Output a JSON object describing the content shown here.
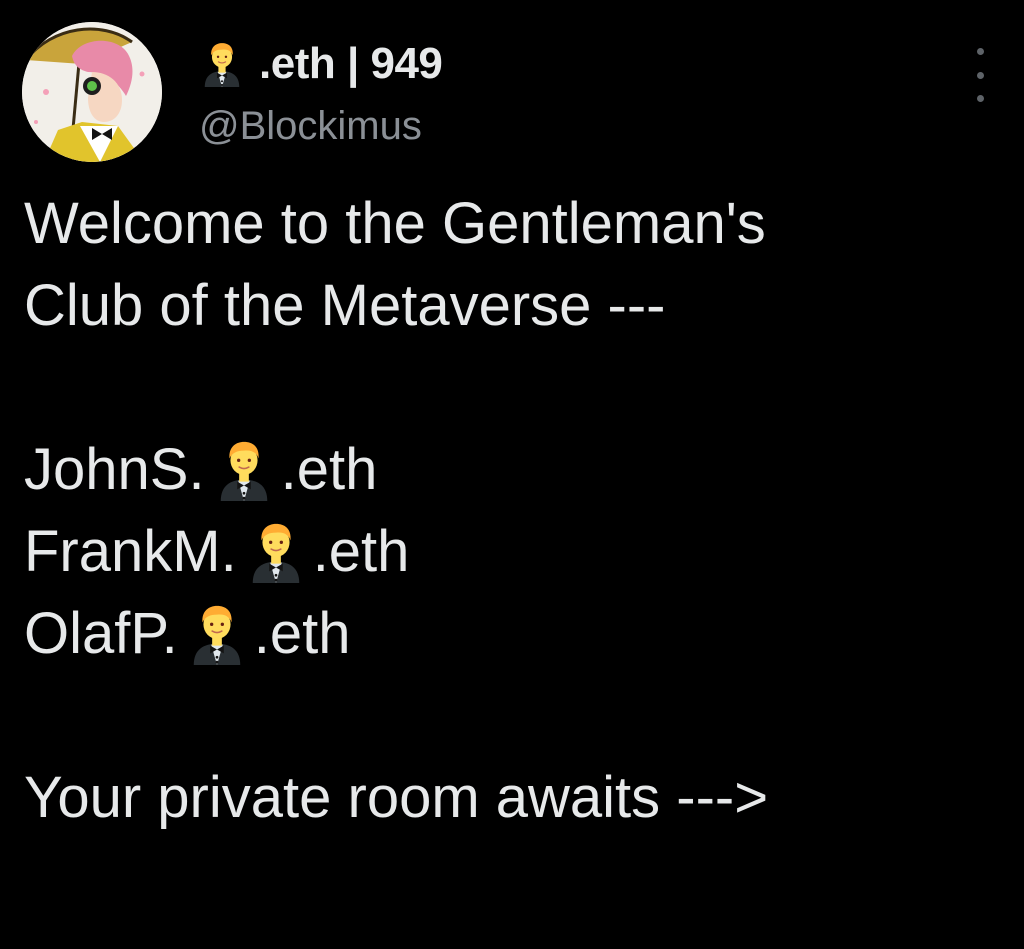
{
  "tweet": {
    "author": {
      "display_name_suffix": ".eth | 949",
      "name_emoji": "man-in-tuxedo-icon",
      "handle": "@Blockimus",
      "avatar": "anime-gentleman-avatar"
    },
    "more_icon": "more-vertical-icon",
    "lines": {
      "line1": "Welcome to the Gentleman's",
      "line2": "Club of the Metaverse ---",
      "member1_prefix": "JohnS.",
      "member1_suffix": ".eth",
      "member2_prefix": "FrankM.",
      "member2_suffix": ".eth",
      "member3_prefix": "OlafP.",
      "member3_suffix": ".eth",
      "closing": "Your private room awaits --->"
    }
  }
}
